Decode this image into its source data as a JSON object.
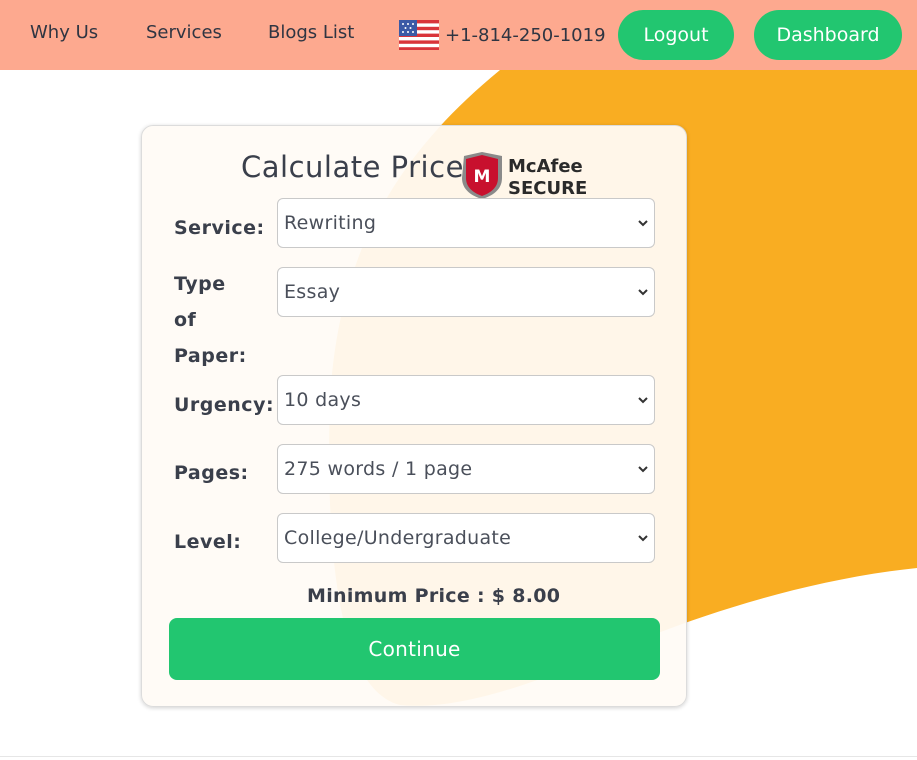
{
  "nav": {
    "links": [
      "Why Us",
      "Services",
      "Blogs List"
    ],
    "phone": "+1-814-250-1019",
    "logout_label": "Logout",
    "dashboard_label": "Dashboard"
  },
  "calculator": {
    "title": "Calculate Price",
    "badge": {
      "brand": "McAfee",
      "tag": "SECURE"
    },
    "fields": [
      {
        "label": "Service:",
        "value": "Rewriting"
      },
      {
        "label": "Type of Paper:",
        "value": "Essay"
      },
      {
        "label": "Urgency:",
        "value": "10 days"
      },
      {
        "label": "Pages:",
        "value": "275 words / 1 page"
      },
      {
        "label": "Level:",
        "value": "College/Undergraduate"
      }
    ],
    "min_price": "Minimum Price : $ 8.00",
    "continue_label": "Continue"
  },
  "colors": {
    "header_bg": "#fda98f",
    "accent_green": "#22c670",
    "blob_orange": "#f9ad22"
  }
}
